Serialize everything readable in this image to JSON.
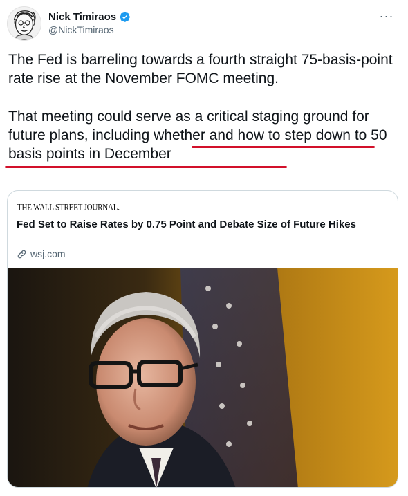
{
  "author": {
    "display_name": "Nick Timiraos",
    "handle": "@NickTimiraos",
    "verified": true,
    "avatar_icon": "avatar-sketch-portrait"
  },
  "actions": {
    "more_icon": "more-horizontal-icon",
    "more_glyph": "···"
  },
  "tweet": {
    "paragraph_1": "The Fed is barreling towards a fourth straight 75-basis-point rate rise at the November FOMC meeting.",
    "paragraph_2": "That meeting could serve as a critical staging ground for future plans, including whether and how to step down to 50 basis points in December",
    "highlight_color": "#d2102a"
  },
  "link_card": {
    "publisher": "THE WALL STREET JOURNAL.",
    "headline": "Fed Set to Raise Rates by 0.75 Point and Debate Size of Future Hikes",
    "domain": "wsj.com",
    "domain_icon": "link-icon",
    "image_icon": "article-photo"
  },
  "colors": {
    "text": "#0f1419",
    "secondary": "#536471",
    "verified": "#1d9bf0",
    "border": "#cfd9de"
  }
}
